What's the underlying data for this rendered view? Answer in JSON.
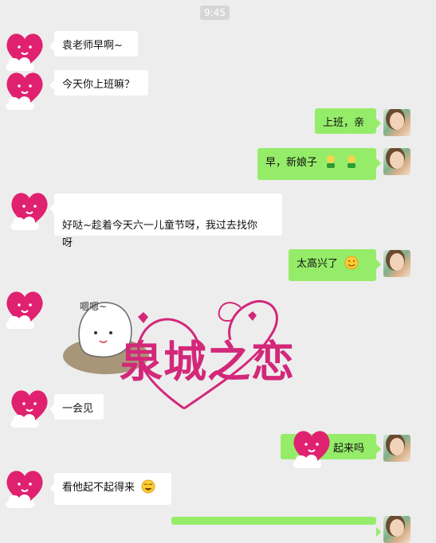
{
  "chat": {
    "timestamp": "9:45",
    "messages": [
      {
        "side": "left",
        "text": "袁老师早啊~"
      },
      {
        "side": "left",
        "text": "今天你上班嘛？"
      },
      {
        "side": "right",
        "text": "上班，亲"
      },
      {
        "side": "right",
        "text": "早，新娘子"
      },
      {
        "side": "left",
        "text": "好哒~趁着今天六一儿童节呀，我过去找你\n呀"
      },
      {
        "side": "right",
        "text": "太高兴了"
      },
      {
        "side": "left",
        "text": "一会见"
      },
      {
        "side": "right",
        "text": "起来吗"
      },
      {
        "side": "left",
        "text": "看他起不起得来"
      }
    ],
    "sticker": {
      "caption": "嗯嗯~",
      "title": "泉城之恋"
    }
  },
  "colors": {
    "background": "#ededed",
    "left_bubble": "#ffffff",
    "right_bubble": "#95ec69",
    "heart": "#e0216f"
  }
}
